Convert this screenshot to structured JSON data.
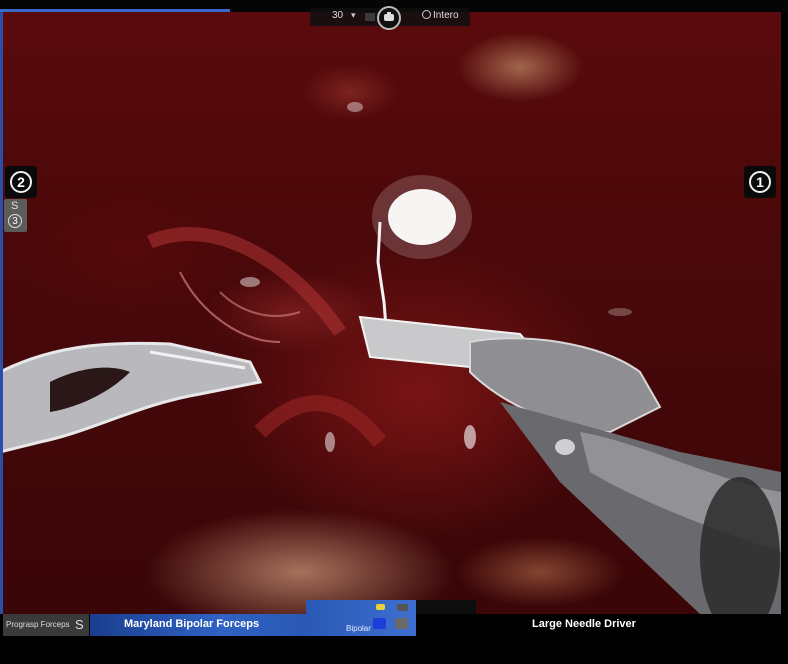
{
  "top_overlay": {
    "zoom_level": "30",
    "camera_icon": "camera-icon",
    "view_mode": "Intero"
  },
  "arms": {
    "left_arm_number": "2",
    "right_arm_number": "1",
    "swap_label": "S",
    "swap_arm_number": "3"
  },
  "instruments": {
    "left_inactive": "Prograsp Forceps",
    "left_inactive_swap": "S",
    "left_active": "Maryland Bipolar Forceps",
    "right": "Large Needle Driver"
  },
  "energy": {
    "label": "Bipolar",
    "colors": {
      "top_pedal": "#e8d23a",
      "bottom_pedal": "#1c3dd6",
      "panel": "#2f62c4"
    }
  }
}
